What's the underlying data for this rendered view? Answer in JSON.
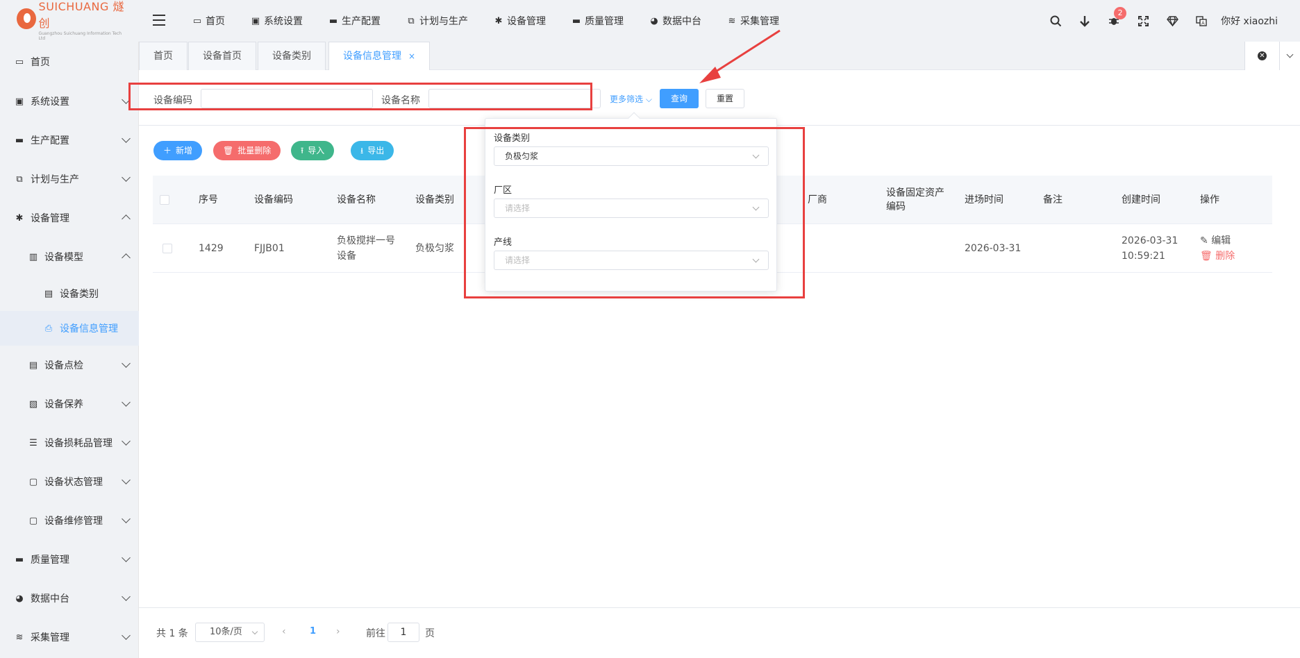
{
  "logo": {
    "main": "SUICHUANG 燧创",
    "sub": "Guangzhou Suichuang Information Tech Ltd"
  },
  "topnav": [
    {
      "label": "首页",
      "icon": "monitor-icon",
      "glyph": "▭"
    },
    {
      "label": "系统设置",
      "icon": "user-card-icon",
      "glyph": "▣"
    },
    {
      "label": "生产配置",
      "icon": "briefcase-icon",
      "glyph": "▬"
    },
    {
      "label": "计划与生产",
      "icon": "window-icon",
      "glyph": "⧉"
    },
    {
      "label": "设备管理",
      "icon": "asterisk-icon",
      "glyph": "✱"
    },
    {
      "label": "质量管理",
      "icon": "briefcase-icon",
      "glyph": "▬"
    },
    {
      "label": "数据中台",
      "icon": "pie-chart-icon",
      "glyph": "◕"
    },
    {
      "label": "采集管理",
      "icon": "database-icon",
      "glyph": "≋"
    }
  ],
  "header_right": {
    "badge_count": "2",
    "user_greeting": "你好 xiaozhi"
  },
  "sidebar": [
    {
      "label": "首页",
      "icon": "monitor-icon",
      "glyph": "▭",
      "indent": 0,
      "arrow": ""
    },
    {
      "label": "系统设置",
      "icon": "user-card-icon",
      "glyph": "▣",
      "indent": 0,
      "arrow": "down"
    },
    {
      "label": "生产配置",
      "icon": "briefcase-icon",
      "glyph": "▬",
      "indent": 0,
      "arrow": "down"
    },
    {
      "label": "计划与生产",
      "icon": "window-icon",
      "glyph": "⧉",
      "indent": 0,
      "arrow": "down"
    },
    {
      "label": "设备管理",
      "icon": "asterisk-icon",
      "glyph": "✱",
      "indent": 0,
      "arrow": "up"
    },
    {
      "label": "设备模型",
      "icon": "columns-icon",
      "glyph": "▥",
      "indent": 1,
      "arrow": "up"
    },
    {
      "label": "设备类别",
      "icon": "server-icon",
      "glyph": "▤",
      "indent": 2,
      "arrow": ""
    },
    {
      "label": "设备信息管理",
      "icon": "printer-icon",
      "glyph": "⎙",
      "indent": 2,
      "arrow": "",
      "active": true
    },
    {
      "label": "设备点检",
      "icon": "server-icon",
      "glyph": "▤",
      "indent": 1,
      "arrow": "down"
    },
    {
      "label": "设备保养",
      "icon": "folder-settings-icon",
      "glyph": "▧",
      "indent": 1,
      "arrow": "down"
    },
    {
      "label": "设备损耗品管理",
      "icon": "list-box-icon",
      "glyph": "☰",
      "indent": 1,
      "arrow": "down"
    },
    {
      "label": "设备状态管理",
      "icon": "folder-icon",
      "glyph": "▢",
      "indent": 1,
      "arrow": "down"
    },
    {
      "label": "设备维修管理",
      "icon": "folder-icon",
      "glyph": "▢",
      "indent": 1,
      "arrow": "down"
    },
    {
      "label": "质量管理",
      "icon": "briefcase-icon",
      "glyph": "▬",
      "indent": 0,
      "arrow": "down"
    },
    {
      "label": "数据中台",
      "icon": "pie-chart-icon",
      "glyph": "◕",
      "indent": 0,
      "arrow": "down"
    },
    {
      "label": "采集管理",
      "icon": "database-icon",
      "glyph": "≋",
      "indent": 0,
      "arrow": "down"
    }
  ],
  "tabs": [
    {
      "label": "首页"
    },
    {
      "label": "设备首页"
    },
    {
      "label": "设备类别"
    },
    {
      "label": "设备信息管理",
      "active": true,
      "close": "×"
    }
  ],
  "search": {
    "code_label": "设备编码",
    "code_value": "",
    "name_label": "设备名称",
    "name_value": "",
    "more_filter": "更多筛选",
    "query_btn": "查询",
    "reset_btn": "重置"
  },
  "actions": {
    "add": "新增",
    "batch_delete": "批量删除",
    "import": "导入",
    "export": "导出"
  },
  "table": {
    "columns": [
      "序号",
      "设备编码",
      "设备名称",
      "设备类别",
      "厂商",
      "设备固定资产编码",
      "进场时间",
      "备注",
      "创建时间",
      "操作"
    ],
    "rows": [
      {
        "seq": "1429",
        "code": "FJJB01",
        "name": "负极搅拌一号设备",
        "category": "负极匀浆",
        "vendor": "",
        "asset_code": "",
        "entry_time": "2026-03-31",
        "remark": "",
        "created": "2026-03-31 10:59:21",
        "edit": "编辑",
        "delete": "删除"
      }
    ]
  },
  "pager": {
    "total": "共 1 条",
    "page_size": "10条/页",
    "current": "1",
    "goto_label": "前往",
    "goto_value": "1",
    "page_suffix": "页"
  },
  "filter_panel": {
    "category_label": "设备类别",
    "category_value": "负极匀浆",
    "plant_label": "厂区",
    "plant_placeholder": "请选择",
    "line_label": "产线",
    "line_placeholder": "请选择"
  },
  "colors": {
    "primary": "#409eff",
    "danger": "#f56c6c",
    "success": "#3fb68b",
    "info": "#3bb7e8",
    "annotation": "#e8403f"
  }
}
